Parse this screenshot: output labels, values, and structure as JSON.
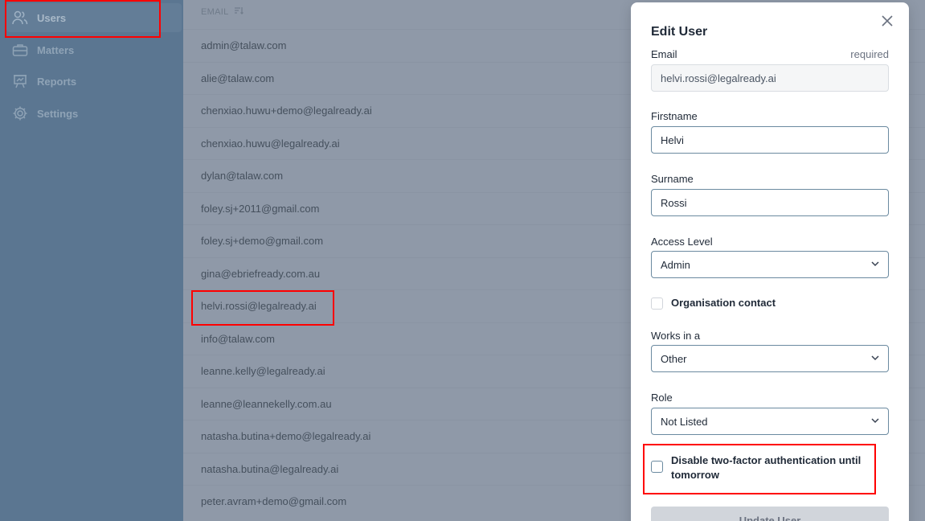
{
  "sidebar": {
    "items": [
      {
        "label": "Users",
        "icon": "users-icon"
      },
      {
        "label": "Matters",
        "icon": "briefcase-icon"
      },
      {
        "label": "Reports",
        "icon": "presentation-chart-icon"
      },
      {
        "label": "Settings",
        "icon": "gear-icon"
      }
    ]
  },
  "table": {
    "column_header": "EMAIL",
    "rows": [
      "admin@talaw.com",
      "alie@talaw.com",
      "chenxiao.huwu+demo@legalready.ai",
      "chenxiao.huwu@legalready.ai",
      "dylan@talaw.com",
      "foley.sj+2011@gmail.com",
      "foley.sj+demo@gmail.com",
      "gina@ebriefready.com.au",
      "helvi.rossi@legalready.ai",
      "info@talaw.com",
      "leanne.kelly@legalready.ai",
      "leanne@leannekelly.com.au",
      "natasha.butina+demo@legalready.ai",
      "natasha.butina@legalready.ai",
      "peter.avram+demo@gmail.com"
    ]
  },
  "modal": {
    "title": "Edit User",
    "email_label": "Email",
    "email_required": "required",
    "email_value": "helvi.rossi@legalready.ai",
    "firstname_label": "Firstname",
    "firstname_value": "Helvi",
    "surname_label": "Surname",
    "surname_value": "Rossi",
    "access_label": "Access Level",
    "access_value": "Admin",
    "org_contact_label": "Organisation contact",
    "works_label": "Works in a",
    "works_value": "Other",
    "role_label": "Role",
    "role_value": "Not Listed",
    "twofa_label": "Disable two-factor authentication until tomorrow",
    "submit_label": "Update User"
  },
  "colors": {
    "sidebar_bg": "#5b7691",
    "highlight": "#ff0000",
    "input_border": "#6b8aa0"
  }
}
